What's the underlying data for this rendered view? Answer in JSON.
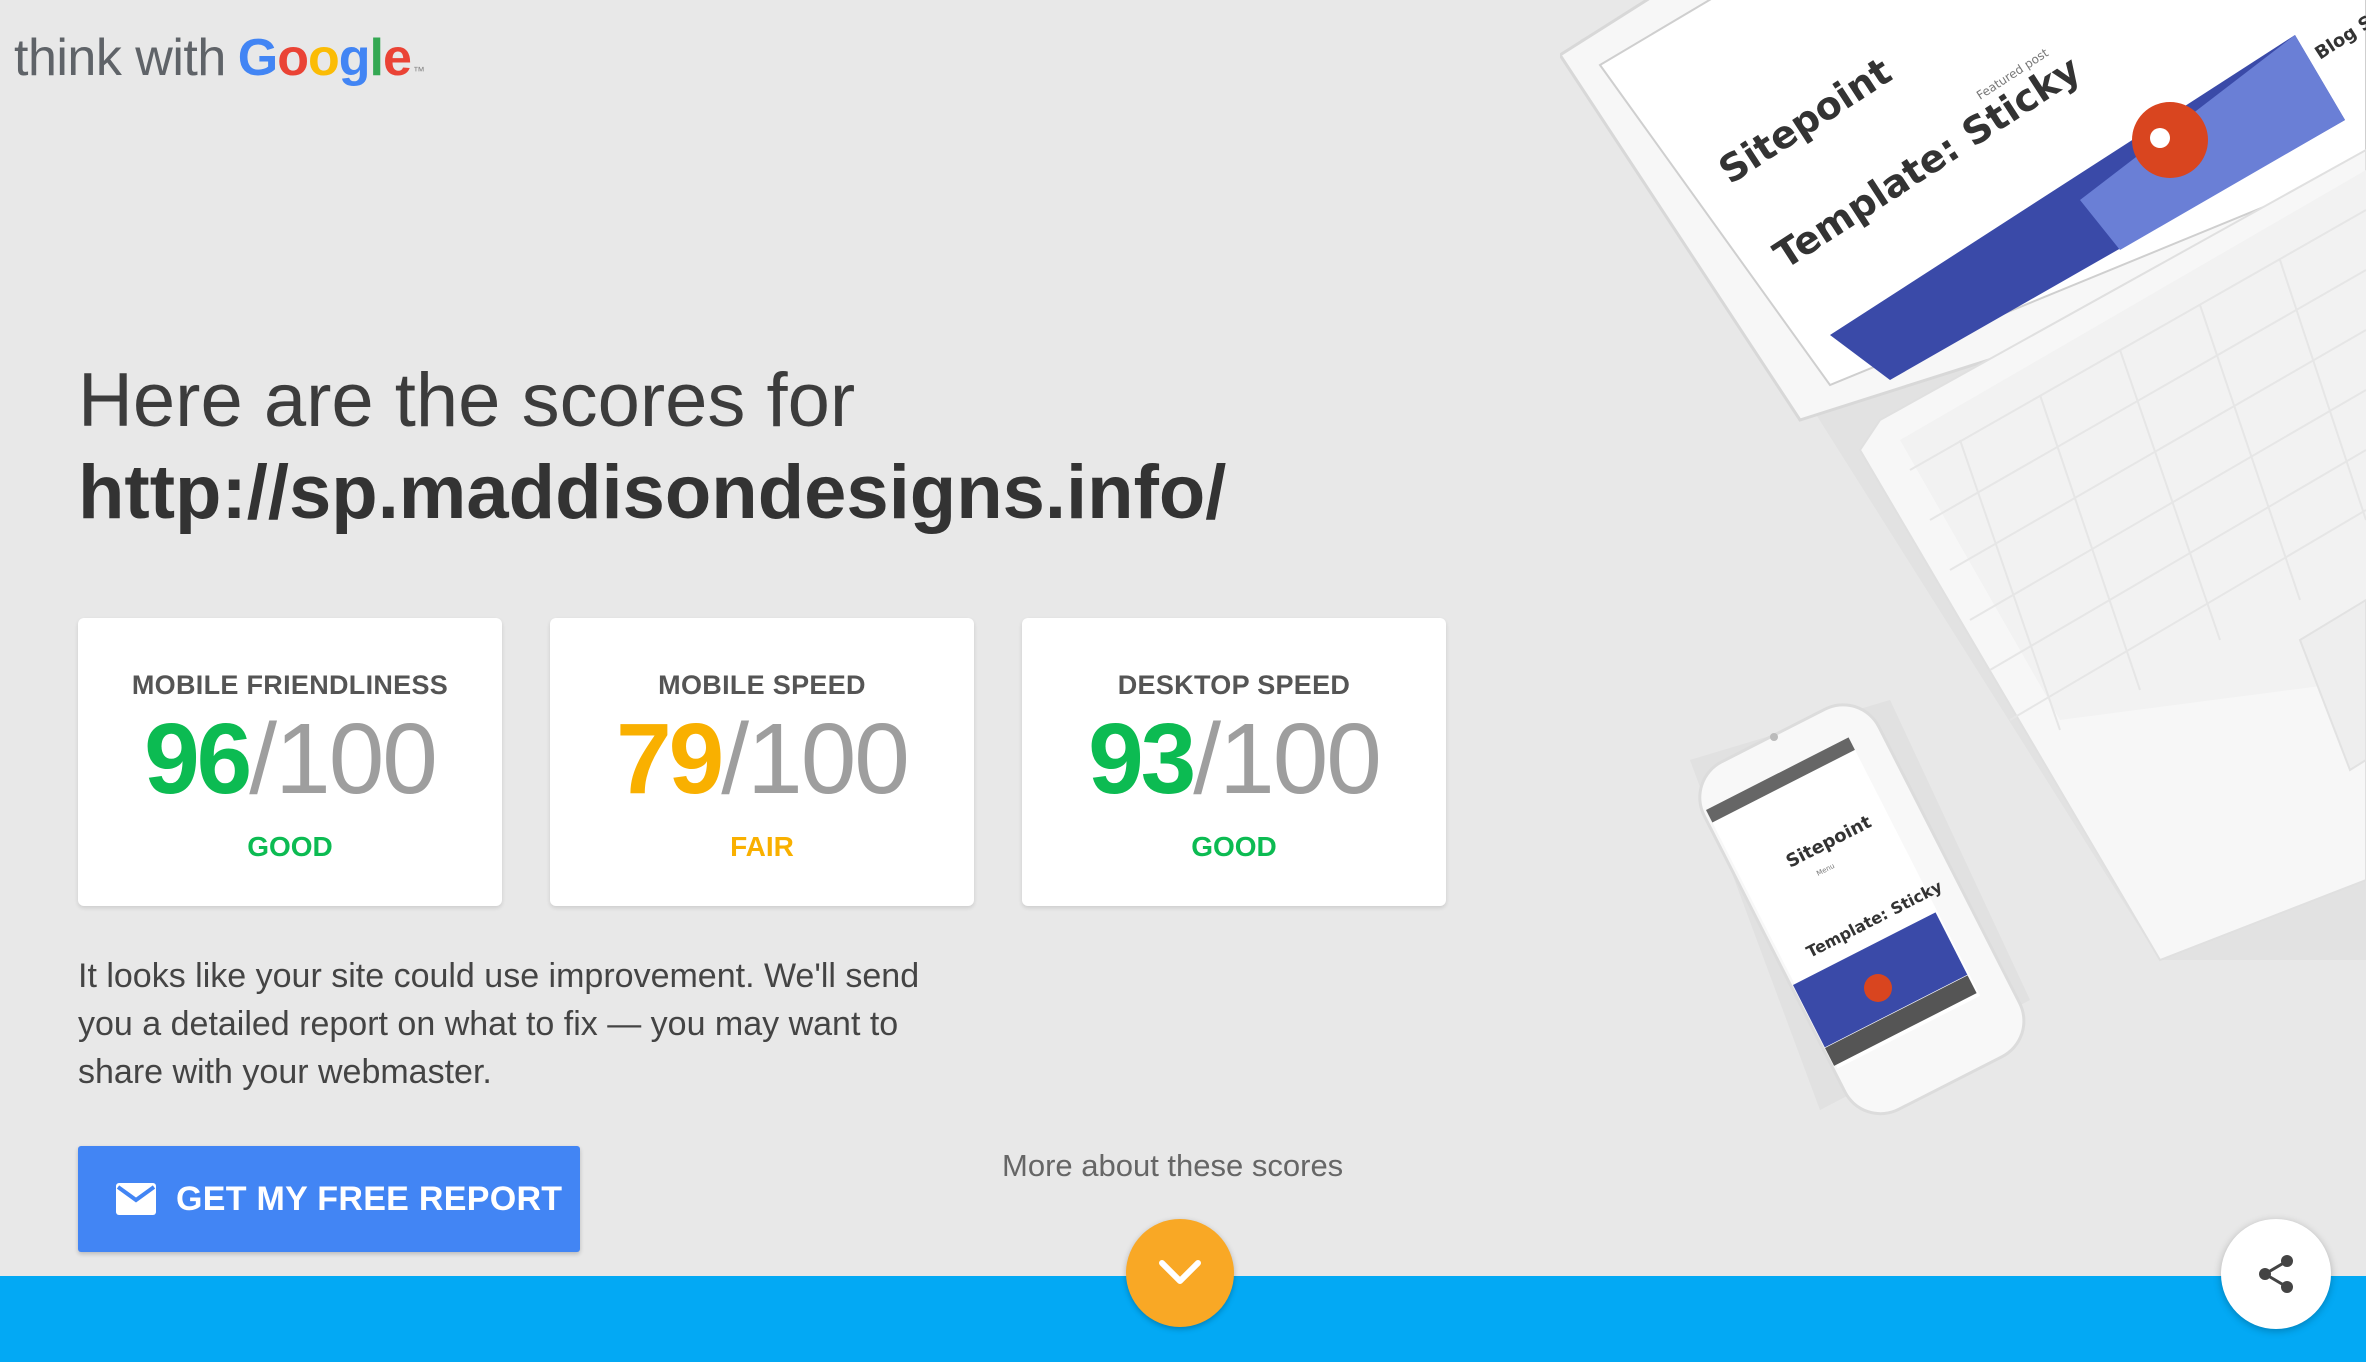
{
  "logo": {
    "prefix": "think with",
    "brand_letters": [
      {
        "ch": "G",
        "color": "#4285F4"
      },
      {
        "ch": "o",
        "color": "#EA4335"
      },
      {
        "ch": "o",
        "color": "#FBBC05"
      },
      {
        "ch": "g",
        "color": "#4285F4"
      },
      {
        "ch": "l",
        "color": "#34A853"
      },
      {
        "ch": "e",
        "color": "#EA4335"
      }
    ],
    "tm": "™"
  },
  "heading": {
    "line1": "Here are the scores for",
    "url": "http://sp.maddisondesigns.info/"
  },
  "scores": [
    {
      "label": "MOBILE FRIENDLINESS",
      "value": "96",
      "max": "/100",
      "rating": "GOOD",
      "color": "#0cbb52"
    },
    {
      "label": "MOBILE SPEED",
      "value": "79",
      "max": "/100",
      "rating": "FAIR",
      "color": "#f9b000"
    },
    {
      "label": "DESKTOP SPEED",
      "value": "93",
      "max": "/100",
      "rating": "GOOD",
      "color": "#0cbb52"
    }
  ],
  "description": "It looks like your site could use improvement. We'll send you a detailed report on what to fix — you may want to share with your webmaster.",
  "report_button": {
    "label": "GET MY FREE REPORT",
    "icon": "mail-icon"
  },
  "more_link": "More about these scores",
  "devices": {
    "site_title": "Sitepoint",
    "post_title": "Template: Sticky",
    "featured": "Featured post",
    "blog": "Blog S",
    "menu": "Menu"
  },
  "colors": {
    "accent_blue": "#4285f4",
    "bar": "#03a9f4",
    "scroll_button": "#f9a825"
  }
}
